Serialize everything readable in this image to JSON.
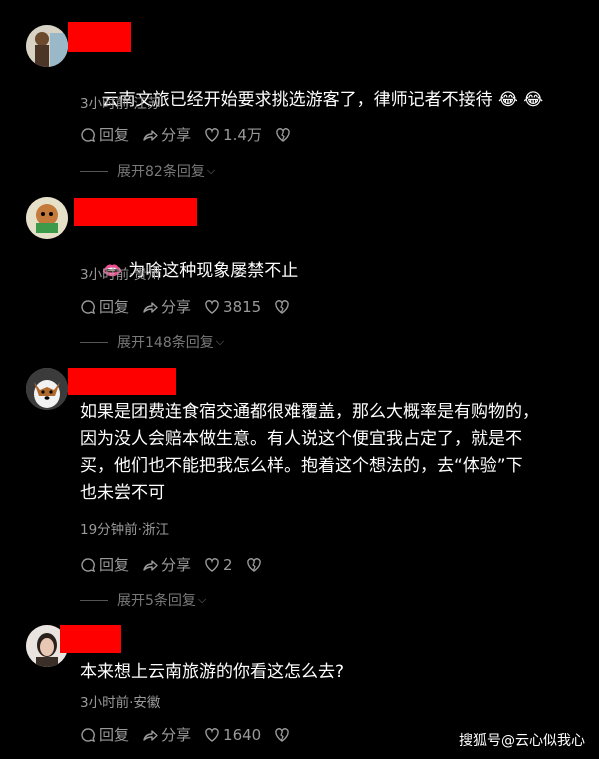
{
  "comments": [
    {
      "text": "云南文旅已经开始要求挑选游客了，律师记者不接待",
      "emoji": "😂 😂",
      "meta": "3小时前·江苏",
      "reply": "回复",
      "share": "分享",
      "likes": "1.4万",
      "expand": "展开82条回复"
    },
    {
      "emoji_prefix": "👄",
      "text": "为啥这种现象屡禁不止",
      "meta": "3小时前·贵州",
      "reply": "回复",
      "share": "分享",
      "likes": "3815",
      "expand": "展开148条回复"
    },
    {
      "text": "如果是团费连食宿交通都很难覆盖，那么大概率是有购物的，\n因为没人会赔本做生意。有人说这个便宜我占定了，就是不\n买，他们也不能把我怎么样。抱着这个想法的，去“体验”下\n也未尝不可",
      "meta": "19分钟前·浙江",
      "reply": "回复",
      "share": "分享",
      "likes": "2",
      "expand": "展开5条回复"
    },
    {
      "text": "本来想上云南旅游的你看这怎么去?",
      "meta": "3小时前·安徽",
      "reply": "回复",
      "share": "分享",
      "likes": "1640"
    }
  ],
  "watermark": "搜狐号@云心似我心",
  "colors": {
    "redact": "#ff0000",
    "background": "#000000",
    "meta": "#9a9a9a"
  },
  "icons": [
    "comment-bubble-icon",
    "share-arrow-icon",
    "heart-icon",
    "broken-heart-icon",
    "chevron-down-icon"
  ]
}
